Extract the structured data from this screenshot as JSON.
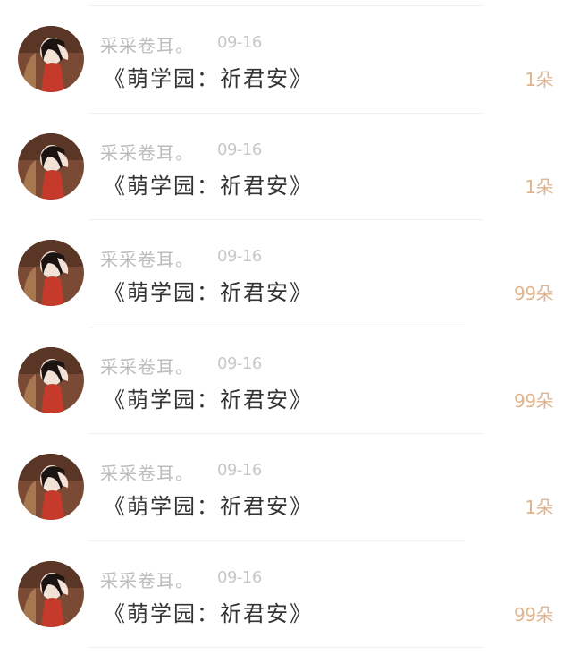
{
  "colors": {
    "username": "#bdbdbd",
    "date": "#c8c8c8",
    "message": "#333333",
    "amount": "#e0b58c",
    "divider": "#f0f0f0"
  },
  "rows": [
    {
      "avatar_icon": "user-avatar-photo",
      "username": "采采卷耳。",
      "date": "09-16",
      "message": "《萌学园：祈君安》",
      "amount": "1朵"
    },
    {
      "avatar_icon": "user-avatar-photo",
      "username": "采采卷耳。",
      "date": "09-16",
      "message": "《萌学园：祈君安》",
      "amount": "1朵"
    },
    {
      "avatar_icon": "user-avatar-photo",
      "username": "采采卷耳。",
      "date": "09-16",
      "message": "《萌学园：祈君安》",
      "amount": "99朵"
    },
    {
      "avatar_icon": "user-avatar-photo",
      "username": "采采卷耳。",
      "date": "09-16",
      "message": "《萌学园：祈君安》",
      "amount": "99朵"
    },
    {
      "avatar_icon": "user-avatar-photo",
      "username": "采采卷耳。",
      "date": "09-16",
      "message": "《萌学园：祈君安》",
      "amount": "1朵"
    },
    {
      "avatar_icon": "user-avatar-photo",
      "username": "采采卷耳。",
      "date": "09-16",
      "message": "《萌学园：祈君安》",
      "amount": "99朵"
    }
  ]
}
